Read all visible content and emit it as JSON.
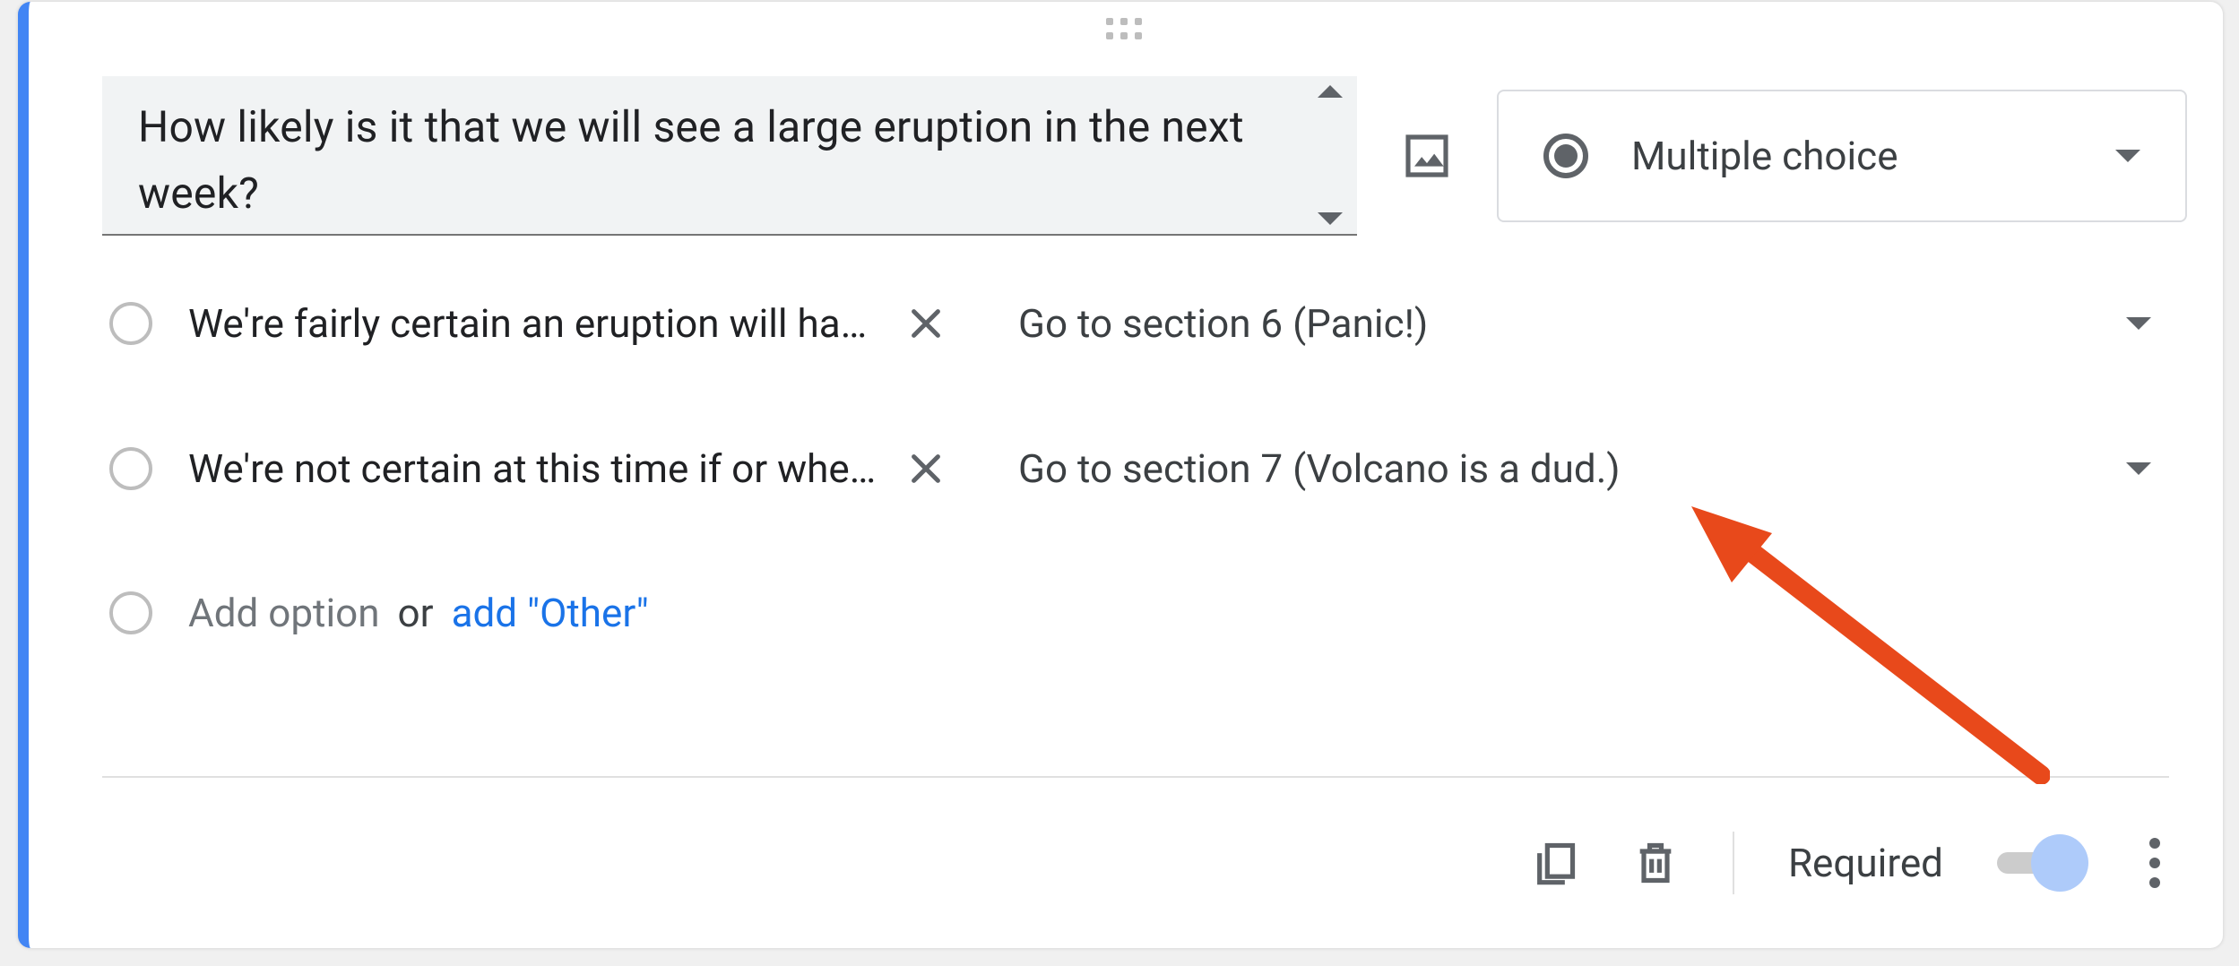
{
  "question": {
    "text": "How likely is it that we will see a large eruption in the next week?",
    "image_icon": "image-icon",
    "type_selector": {
      "label": "Multiple choice"
    }
  },
  "options": [
    {
      "text": "We're fairly certain an eruption will hap…",
      "goto": "Go to section 6 (Panic!)"
    },
    {
      "text": "We're not certain at this time if or when…",
      "goto": "Go to section 7 (Volcano is a dud.)"
    }
  ],
  "add_option": {
    "placeholder": "Add option",
    "or": "or",
    "other": "add \"Other\""
  },
  "footer": {
    "required_label": "Required"
  }
}
